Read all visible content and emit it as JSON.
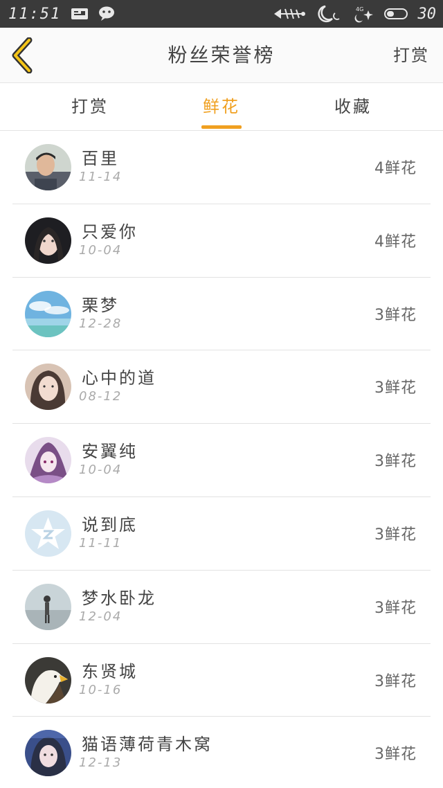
{
  "status_bar": {
    "time": "11:51",
    "battery_level": "30",
    "icons": [
      "notification-card-icon",
      "wechat-icon",
      "fish-bone-icon",
      "moon-icon",
      "signal-4g-icon",
      "battery-icon"
    ]
  },
  "header": {
    "title": "粉丝荣誉榜",
    "right_link": "打赏"
  },
  "tabs": [
    {
      "label": "打赏",
      "active": false
    },
    {
      "label": "鲜花",
      "active": true
    },
    {
      "label": "收藏",
      "active": false
    }
  ],
  "accent_color": "#f0a020",
  "fans": [
    {
      "name": "百里",
      "date": "11-14",
      "count": "4鲜花"
    },
    {
      "name": "只爱你",
      "date": "10-04",
      "count": "4鲜花"
    },
    {
      "name": "栗梦",
      "date": "12-28",
      "count": "3鲜花"
    },
    {
      "name": "心中的道",
      "date": "08-12",
      "count": "3鲜花"
    },
    {
      "name": "安翼纯",
      "date": "10-04",
      "count": "3鲜花"
    },
    {
      "name": "说到底",
      "date": "11-11",
      "count": "3鲜花"
    },
    {
      "name": "梦水卧龙",
      "date": "12-04",
      "count": "3鲜花"
    },
    {
      "name": "东贤城",
      "date": "10-16",
      "count": "3鲜花"
    },
    {
      "name": "猫语薄荷青木窝",
      "date": "12-13",
      "count": "3鲜花"
    }
  ]
}
